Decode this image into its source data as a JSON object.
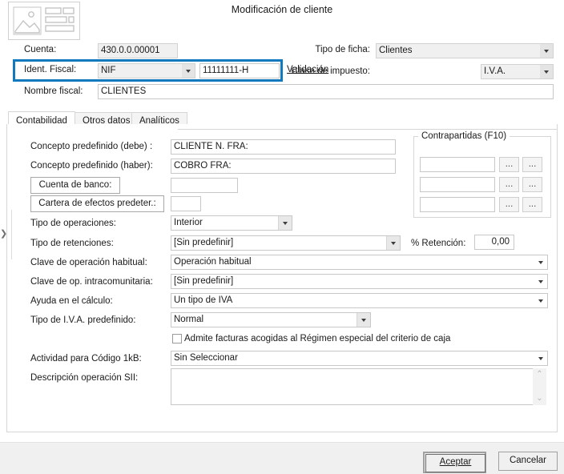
{
  "dialog": {
    "title": "Modificación de cliente",
    "icon": "id-card-icon"
  },
  "header": {
    "cuenta_label": "Cuenta:",
    "cuenta_value": "430.0.0.00001",
    "ident_fiscal_label": "Ident. Fiscal:",
    "ident_fiscal_type": "NIF",
    "ident_fiscal_value": "11111111-H",
    "validacion_link": "Validación",
    "nombre_fiscal_label": "Nombre fiscal:",
    "nombre_fiscal_value": "CLIENTES",
    "tipo_ficha_label": "Tipo de ficha:",
    "tipo_ficha_value": "Clientes",
    "clase_impuesto_label": "Clase de impuesto:",
    "clase_impuesto_value": "I.V.A.",
    "highlight_color": "#1279bf"
  },
  "tabs": [
    {
      "label": "Contabilidad",
      "active": true
    },
    {
      "label": "Otros datos",
      "active": false
    },
    {
      "label": "Analíticos",
      "active": false
    }
  ],
  "contabilidad": {
    "concepto_debe_label": "Concepto predefinido (debe) :",
    "concepto_debe_value": "CLIENTE N. FRA:",
    "concepto_haber_label": "Concepto predefinido (haber):",
    "concepto_haber_value": "COBRO FRA:",
    "cuenta_banco_button": "Cuenta de banco:",
    "cuenta_banco_value": "",
    "cartera_efectos_button": "Cartera de efectos predeter.:",
    "cartera_efectos_value": "",
    "tipo_operaciones_label": "Tipo de operaciones:",
    "tipo_operaciones_value": "Interior",
    "tipo_retenciones_label": "Tipo de retenciones:",
    "tipo_retenciones_value": "[Sin predefinir]",
    "pct_retencion_label": "% Retención:",
    "pct_retencion_value": "0,00",
    "clave_operacion_label": "Clave de operación habitual:",
    "clave_operacion_value": "Operación habitual",
    "clave_intracomunitaria_label": "Clave de op. intracomunitaria:",
    "clave_intracomunitaria_value": "[Sin predefinir]",
    "ayuda_calculo_label": "Ayuda en el cálculo:",
    "ayuda_calculo_value": "Un tipo de IVA",
    "tipo_iva_label": "Tipo de I.V.A. predefinido:",
    "tipo_iva_value": "Normal",
    "criterio_caja_checkbox_label": "Admite facturas acogidas al Régimen especial del criterio de caja",
    "criterio_caja_checked": false,
    "actividad_label": "Actividad para Código 1kB:",
    "actividad_value": "Sin Seleccionar",
    "descripcion_sii_label": "Descripción operación SII:",
    "descripcion_sii_value": ""
  },
  "contrapartidas": {
    "legend": "Contrapartidas (F10)",
    "rows": [
      {
        "value": "",
        "btn1": "...",
        "btn2": "..."
      },
      {
        "value": "",
        "btn1": "...",
        "btn2": "..."
      },
      {
        "value": "",
        "btn1": "...",
        "btn2": "..."
      }
    ]
  },
  "footer": {
    "accept_label": "Aceptar",
    "cancel_label": "Cancelar"
  },
  "icons": {
    "caret_down": "▾",
    "chevron_up": "⌃",
    "chevron_down": "⌄",
    "edge_arrow": "❯"
  }
}
